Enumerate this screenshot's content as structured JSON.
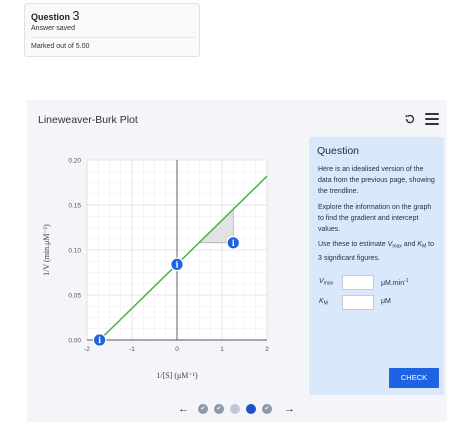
{
  "question_info": {
    "label": "Question",
    "number": "3",
    "status": "Answer saved",
    "marks": "Marked out of 5.00"
  },
  "app": {
    "title": "Lineweaver-Burk Plot",
    "undo_icon": "undo-icon",
    "menu_icon": "hamburger-menu-icon"
  },
  "chart_data": {
    "type": "line",
    "title": "",
    "xlabel": "1/[S] (μM⁻¹)",
    "ylabel": "1/V (min.μM⁻¹)",
    "xlim": [
      -2,
      2
    ],
    "ylim": [
      0,
      0.2
    ],
    "x_ticks": [
      "-2",
      "-1",
      "0",
      "1",
      "2"
    ],
    "y_ticks": [
      "0.00",
      "0.05",
      "0.10",
      "0.15",
      "0.20"
    ],
    "grid": true,
    "series": [
      {
        "x": [
          -1.72,
          2.0
        ],
        "y": [
          0.0,
          0.182
        ],
        "color": "#4caf50"
      }
    ],
    "info_points": [
      {
        "x": -1.72,
        "y": 0.0,
        "label": "i"
      },
      {
        "x": 0.0,
        "y": 0.084,
        "label": "i"
      },
      {
        "x": 1.25,
        "y": 0.108,
        "label": "i"
      }
    ],
    "gradient_triangle": {
      "x1": 0.5,
      "y1": 0.108,
      "x2": 1.25,
      "y2": 0.145
    }
  },
  "panel": {
    "title": "Question",
    "text1": "Here is an idealised version of the data from the previous page, showing the trendline.",
    "text2": "Explore the information on the graph to find the gradient and intercept values.",
    "text3a": "Use these to estimate ",
    "text3b": " and ",
    "text3c": " to 3 significant figures.",
    "vmax_sym": "V",
    "vmax_sub": "max",
    "km_sym": "K",
    "km_sub": "M",
    "vmax_value": "",
    "vmax_unit": "μM.min",
    "vmax_unit_sup": "-1",
    "km_value": "",
    "km_unit": "μM",
    "check_label": "CHECK"
  },
  "pager": {
    "prev": "←",
    "next": "→",
    "check_glyph": "✔",
    "dots": [
      "done",
      "done",
      "empty",
      "current",
      "done"
    ]
  }
}
